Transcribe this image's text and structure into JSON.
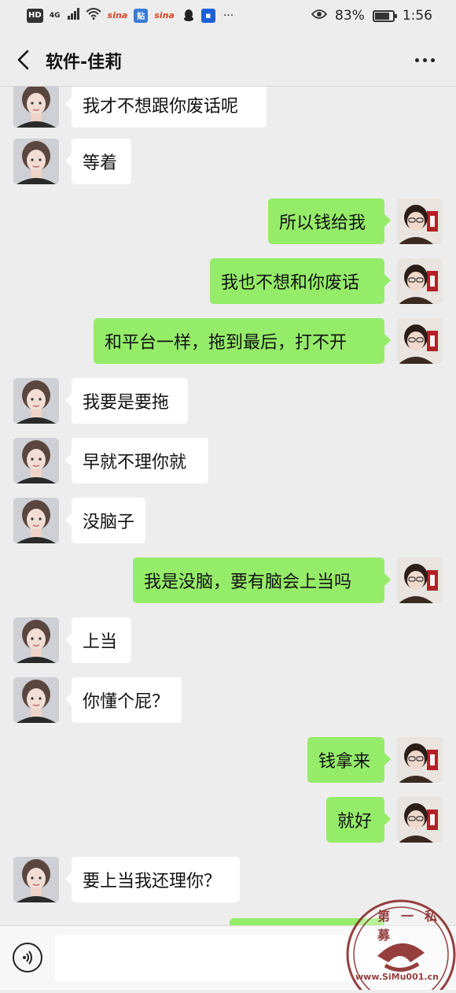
{
  "status_bar": {
    "hd": "HD",
    "network": "4G",
    "sina1": "sina",
    "tie": "贴",
    "sina2": "sina",
    "more": "···",
    "battery": "83%",
    "battery_level": 0.83,
    "time": "1:56"
  },
  "header": {
    "title": "软件-佳莉"
  },
  "messages": [
    {
      "side": "in",
      "text": "我才不想跟你废话呢"
    },
    {
      "side": "in",
      "text": "等着"
    },
    {
      "side": "out",
      "text": "所以钱给我"
    },
    {
      "side": "out",
      "text": "我也不想和你废话"
    },
    {
      "side": "out",
      "text": "和平台一样，拖到最后，打不开"
    },
    {
      "side": "in",
      "text": "我要是要拖"
    },
    {
      "side": "in",
      "text": "早就不理你就"
    },
    {
      "side": "in",
      "text": "没脑子"
    },
    {
      "side": "out",
      "text": "我是没脑，要有脑会上当吗"
    },
    {
      "side": "in",
      "text": "上当"
    },
    {
      "side": "in",
      "text": "你懂个屁？"
    },
    {
      "side": "out",
      "text": "钱拿来"
    },
    {
      "side": "out",
      "text": "就好"
    },
    {
      "side": "in",
      "text": "要上当我还理你？"
    }
  ],
  "input": {
    "placeholder": ""
  },
  "watermark": {
    "text": "第一私募",
    "url_text": "www.SiMu001.cn"
  },
  "colors": {
    "background": "#ededed",
    "incoming_bubble": "#ffffff",
    "outgoing_bubble": "#95ec69"
  },
  "icons": {
    "back": "chevron-left-icon",
    "more": "more-dots-icon",
    "voice": "voice-icon"
  }
}
